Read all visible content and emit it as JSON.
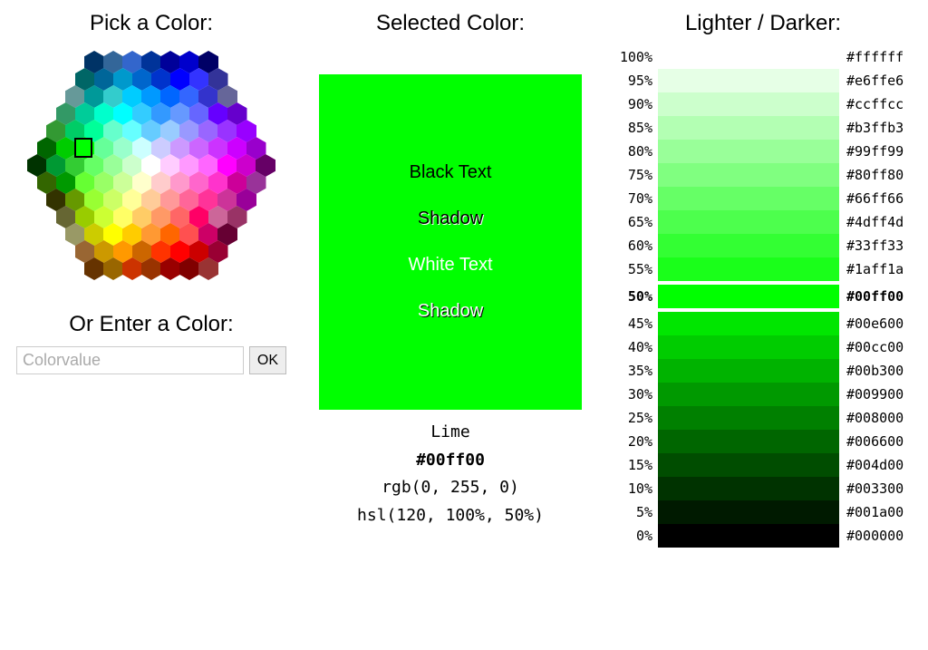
{
  "picker": {
    "title": "Pick a Color:",
    "enter_title": "Or Enter a Color:",
    "input_placeholder": "Colorvalue",
    "ok_label": "OK",
    "hex_rows": [
      [
        "#003366",
        "#336699",
        "#3366cc",
        "#003399",
        "#000099",
        "#0000cc",
        "#000066"
      ],
      [
        "#006666",
        "#006699",
        "#0099cc",
        "#0066cc",
        "#0033cc",
        "#0000ff",
        "#3333ff",
        "#333399"
      ],
      [
        "#669999",
        "#009999",
        "#33cccc",
        "#00ccff",
        "#0099ff",
        "#0066ff",
        "#3366ff",
        "#3333cc",
        "#666699"
      ],
      [
        "#339966",
        "#00cc99",
        "#00ffcc",
        "#00ffff",
        "#33ccff",
        "#3399ff",
        "#6699ff",
        "#6666ff",
        "#6600ff",
        "#6600cc"
      ],
      [
        "#339933",
        "#00cc66",
        "#00ff99",
        "#66ffcc",
        "#66ffff",
        "#66ccff",
        "#99ccff",
        "#9999ff",
        "#9966ff",
        "#9933ff",
        "#9900ff"
      ],
      [
        "#006600",
        "#00cc00",
        "#00ff00",
        "#66ff99",
        "#99ffcc",
        "#ccffff",
        "#ccccff",
        "#cc99ff",
        "#cc66ff",
        "#cc33ff",
        "#cc00ff",
        "#9900cc"
      ],
      [
        "#003300",
        "#009933",
        "#33cc33",
        "#66ff66",
        "#99ff99",
        "#ccffcc",
        "#ffffff",
        "#ffccff",
        "#ff99ff",
        "#ff66ff",
        "#ff00ff",
        "#cc00cc",
        "#660066"
      ],
      [
        "#336600",
        "#009900",
        "#66ff33",
        "#99ff66",
        "#ccff99",
        "#ffffcc",
        "#ffcccc",
        "#ff99cc",
        "#ff66cc",
        "#ff33cc",
        "#cc0099",
        "#993399"
      ],
      [
        "#333300",
        "#669900",
        "#99ff33",
        "#ccff66",
        "#ffff99",
        "#ffcc99",
        "#ff9999",
        "#ff6699",
        "#ff3399",
        "#cc3399",
        "#990099"
      ],
      [
        "#666633",
        "#99cc00",
        "#ccff33",
        "#ffff66",
        "#ffcc66",
        "#ff9966",
        "#ff6666",
        "#ff0066",
        "#cc6699",
        "#993366"
      ],
      [
        "#999966",
        "#cccc00",
        "#ffff00",
        "#ffcc00",
        "#ff9933",
        "#ff6600",
        "#ff5050",
        "#cc0066",
        "#660033"
      ],
      [
        "#996633",
        "#cc9900",
        "#ff9900",
        "#cc6600",
        "#ff3300",
        "#ff0000",
        "#cc0000",
        "#990033"
      ],
      [
        "#663300",
        "#996600",
        "#cc3300",
        "#993300",
        "#990000",
        "#800000",
        "#993333"
      ]
    ],
    "selected_position": {
      "row": 5,
      "col": 2
    }
  },
  "selected": {
    "title": "Selected Color:",
    "color": "#00ff00",
    "labels": {
      "black": "Black Text",
      "black_shadow": "Shadow",
      "white": "White Text",
      "white_shadow": "Shadow"
    },
    "meta": {
      "name": "Lime",
      "hex": "#00ff00",
      "rgb": "rgb(0, 255, 0)",
      "hsl": "hsl(120, 100%, 50%)"
    }
  },
  "scale": {
    "title": "Lighter / Darker:",
    "rows": [
      {
        "pct": "100%",
        "hex": "#ffffff"
      },
      {
        "pct": "95%",
        "hex": "#e6ffe6"
      },
      {
        "pct": "90%",
        "hex": "#ccffcc"
      },
      {
        "pct": "85%",
        "hex": "#b3ffb3"
      },
      {
        "pct": "80%",
        "hex": "#99ff99"
      },
      {
        "pct": "75%",
        "hex": "#80ff80"
      },
      {
        "pct": "70%",
        "hex": "#66ff66"
      },
      {
        "pct": "65%",
        "hex": "#4dff4d"
      },
      {
        "pct": "60%",
        "hex": "#33ff33"
      },
      {
        "pct": "55%",
        "hex": "#1aff1a"
      },
      {
        "pct": "50%",
        "hex": "#00ff00",
        "current": true
      },
      {
        "pct": "45%",
        "hex": "#00e600"
      },
      {
        "pct": "40%",
        "hex": "#00cc00"
      },
      {
        "pct": "35%",
        "hex": "#00b300"
      },
      {
        "pct": "30%",
        "hex": "#009900"
      },
      {
        "pct": "25%",
        "hex": "#008000"
      },
      {
        "pct": "20%",
        "hex": "#006600"
      },
      {
        "pct": "15%",
        "hex": "#004d00"
      },
      {
        "pct": "10%",
        "hex": "#003300"
      },
      {
        "pct": "5%",
        "hex": "#001a00"
      },
      {
        "pct": "0%",
        "hex": "#000000"
      }
    ]
  }
}
